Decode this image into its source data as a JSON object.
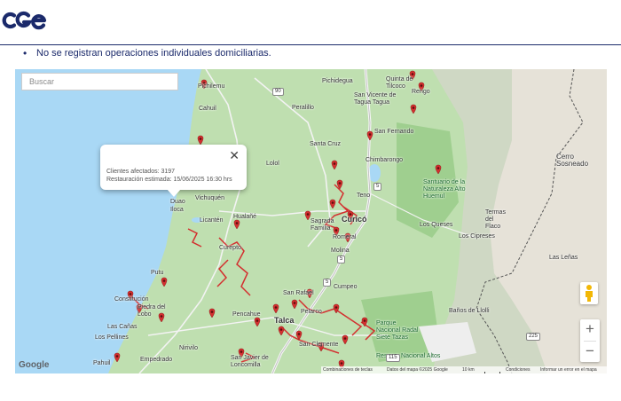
{
  "brand": {
    "logo_text": "cge",
    "color": "#1b2a6b"
  },
  "notice": {
    "text": "No se registran operaciones individuales domiciliarias."
  },
  "map": {
    "search": {
      "placeholder": "Buscar",
      "value": ""
    },
    "info_window": {
      "line1": "Clientes afectados: 3197",
      "line2": "Restauración estimada: 15/06/2025 16:30 hrs",
      "close_icon": "close-icon"
    },
    "places": [
      "Pichilemu",
      "Cahuil",
      "Pichidegua",
      "Quinta de Tilcoco",
      "Rengo",
      "Peralillo",
      "San Vicente de Tagua Tagua",
      "San Fernando",
      "Santa Cruz",
      "Chimbarongo",
      "Lolol",
      "Cerro Sosneado",
      "Santuario de la Naturaleza Alto Huemul",
      "Teno",
      "Duao",
      "Iloca",
      "Vichuquén",
      "Licantén",
      "Hualañé",
      "Curicó",
      "Sagrada Familia",
      "Romeral",
      "Termas del Flaco",
      "Los Queses",
      "Los Cipreses",
      "Molina",
      "Curepto",
      "Las Leñas",
      "Putu",
      "San Rafael",
      "Cumpeo",
      "Constitución",
      "Piedra del Lobo",
      "Pelarco",
      "Pencahue",
      "Talca",
      "Baños de Llolli",
      "Parque Nacional Radal Siete Tazas",
      "Las Cañas",
      "Los Pellines",
      "Nirivilo",
      "San Clemente",
      "Empedrado",
      "San Javier de Loncomilla",
      "Pahuil",
      "Reserva Nacional Altos"
    ],
    "road_numbers": [
      "90",
      "5",
      "5",
      "5",
      "115",
      "225"
    ],
    "controls": {
      "zoom_in": "+",
      "zoom_out": "−",
      "street_view": "pegman-icon"
    },
    "attribution": {
      "google": "Google",
      "shortcuts": "Combinaciones de teclas",
      "data": "Datos del mapa ©2025 Google",
      "scale": "10 km",
      "terms": "Condiciones",
      "report": "Informar un error en el mapa"
    },
    "outage_color": "#d32f2f"
  }
}
